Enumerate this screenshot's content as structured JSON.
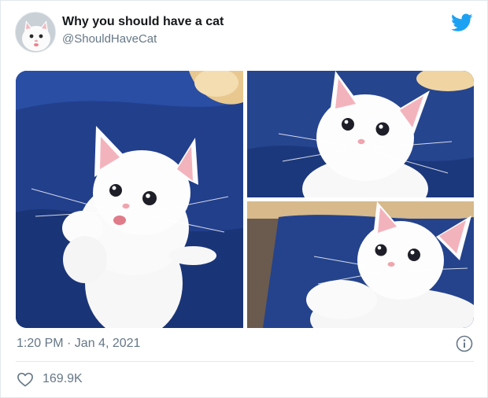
{
  "tweet": {
    "display_name": "Why you should have a cat",
    "handle": "@ShouldHaveCat",
    "timestamp": "1:20 PM · Jan 4, 2021",
    "like_count": "169.9K",
    "avatar_icon": "white-kitten-avatar",
    "brand_icon": "twitter-bird-icon",
    "brand_color": "#1da1f2"
  },
  "media": {
    "photos": [
      {
        "subject": "white kitten standing on hind legs on blue blanket"
      },
      {
        "subject": "white kitten close-up on blue blanket"
      },
      {
        "subject": "white kitten lying on blue chair"
      }
    ]
  },
  "icons": {
    "info": "info-circle-icon",
    "like": "heart-icon"
  }
}
